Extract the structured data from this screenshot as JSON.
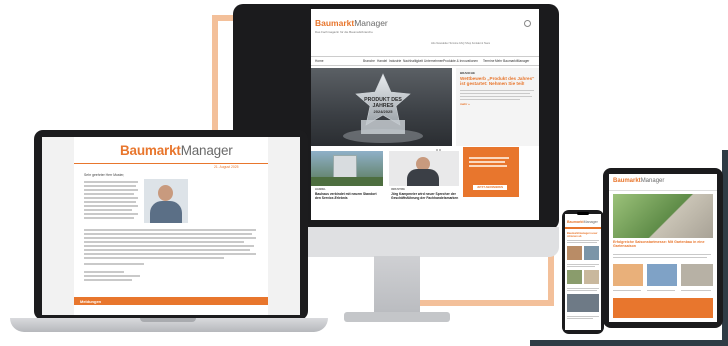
{
  "brand": {
    "name_part1": "Baumarkt",
    "name_part2": "Manager",
    "tagline": "Das Fachmagazin für die Baumarktbranche",
    "accent_color": "#e8762d",
    "gray_color": "#6a6a6a"
  },
  "desktop": {
    "top_links": "Abo  Newsletter  Termine  FAQ  Shop  Kontakt & Team",
    "nav_items": [
      "Home",
      "Branche",
      "Handel",
      "Industrie",
      "Nachhaltigkeit",
      "Unternehmen",
      "Produkte & Innovationen",
      "Termine",
      "Mehr BaumarktManager"
    ],
    "hero_badge_line1": "PRODUKT DES JAHRES",
    "hero_badge_line2": "2024/2025",
    "hero_side_kicker": "BRANCHE",
    "hero_side_title": "Wettbewerb „Produkt des Jahres“ ist gestartet: Nehmen Sie teil!",
    "hero_side_more": "mehr »",
    "card1_kicker": "HANDEL",
    "card1_title": "Bauhaus verbindet mit neuem Standort den Service-Erlebnis",
    "card2_kicker": "INDUSTRIE",
    "card2_title": "Jörg Kampmeier wird neuer Sprecher der Geschäftsführung der Fachhandelsmarken",
    "ad_button": "JETZT ABONNIEREN"
  },
  "laptop": {
    "date": "21. August 2025",
    "greeting": "Sehr geehrter Herr Muster,",
    "footer_section": "Meldungen"
  },
  "tablet": {
    "headline": "Erfolgreiche Saisonstartmesse: Mit Gartenbau in eine Gartensaison"
  },
  "phone": {
    "headline": "Baumarktmanager-Leser stimmen ab"
  }
}
